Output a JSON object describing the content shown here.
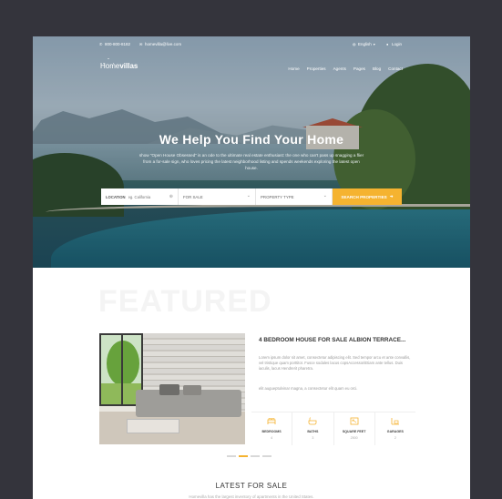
{
  "topbar": {
    "phone": "800-800-8182",
    "email": "homevilla@live.com",
    "language": "English",
    "login": "Login"
  },
  "brand": {
    "logo_part1": "Home",
    "logo_part2": "villas"
  },
  "nav": [
    "Home",
    "Properties",
    "Agents",
    "Pages",
    "Blog",
    "Contact"
  ],
  "hero": {
    "headline": "We Help You Find Your Home",
    "subline": "show \"Open House Obsessed\" is an ode to the ultimate real estate enthusiast: the one who can't pass up snagging a flier from a for-sale sign, who loves pricing the latest neighborhood listing and spends weekends exploring the latest open house."
  },
  "search": {
    "location_label": "LOCATION",
    "location_placeholder": "eg. California",
    "status_value": "FOR SALE",
    "type_value": "PROPERTY TYPE",
    "button_label": "SEARCH PROPERTIES"
  },
  "featured": {
    "watermark": "FEATURED",
    "title": "4 BEDROOM HOUSE FOR SALE ALBION TERRACE...",
    "description": "Lorem ipsum dolor sit amet, consectetur adipiscing elit. Sed tempor arcu et ante convallis, vel tristique quam porttitor. Fusce sodales lacus copsAccessoriEtiam ante tellus. Duis iaculis, lacus Hendrerit pharetra.",
    "description2": "elit augueptulvinar magna, a consectetur elit quam eu orci.",
    "stats": [
      {
        "icon": "bed-icon",
        "label": "BEDROOMS",
        "value": "4"
      },
      {
        "icon": "bath-icon",
        "label": "BATHS",
        "value": "3"
      },
      {
        "icon": "area-icon",
        "label": "SQUARE FEET",
        "value": "2500"
      },
      {
        "icon": "garage-icon",
        "label": "GARAGES",
        "value": "2"
      }
    ]
  },
  "latest": {
    "title": "LATEST FOR SALE",
    "subtitle": "Homevilla has the largest inventory of apartments in the United States."
  },
  "colors": {
    "accent": "#f5b330",
    "background": "#34343c"
  }
}
